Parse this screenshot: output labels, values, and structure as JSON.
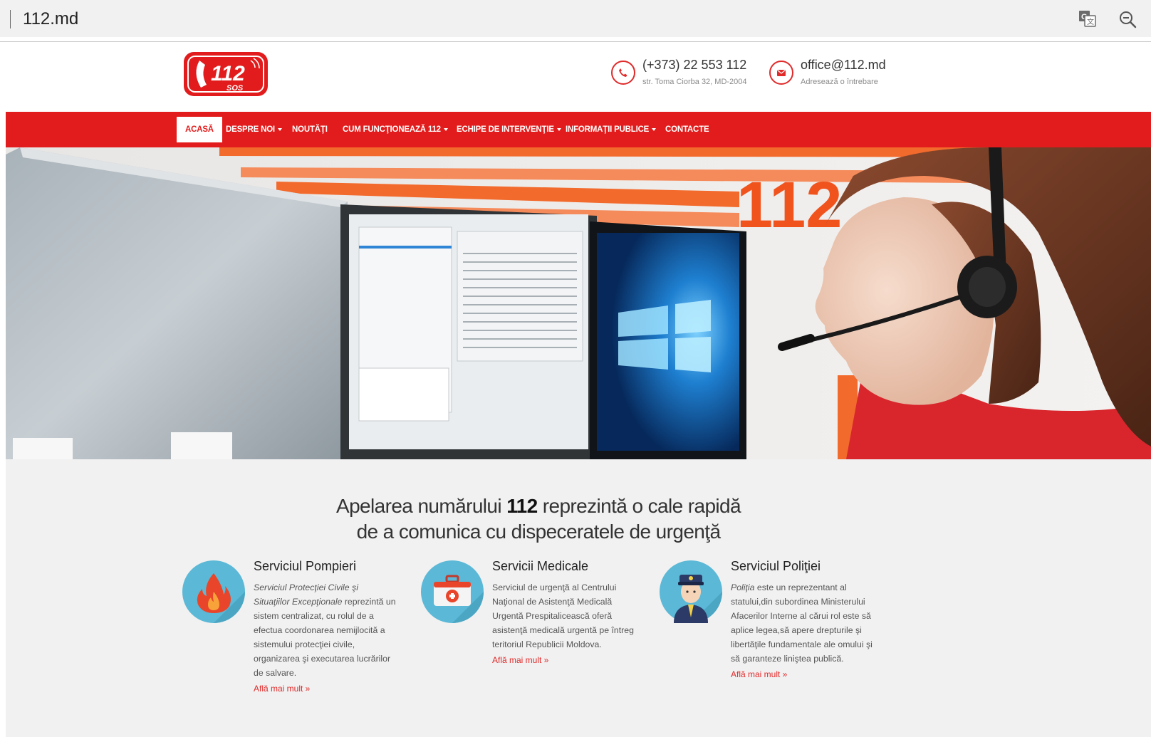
{
  "browser": {
    "url": "112.md",
    "icons": [
      "translate-icon",
      "zoom-out-icon"
    ]
  },
  "header": {
    "logo": {
      "main": "112",
      "sub": "SOS"
    },
    "phone": {
      "main": "(+373) 22 553 112",
      "sub": "str. Toma Ciorba 32, MD-2004",
      "icon": "phone-icon"
    },
    "email": {
      "main": "office@112.md",
      "sub": "Adresează o întrebare",
      "icon": "envelope-icon"
    }
  },
  "nav": {
    "items": [
      {
        "label": "ACASĂ",
        "active": true,
        "dropdown": false
      },
      {
        "label": "DESPRE NOI",
        "dropdown": true
      },
      {
        "label": "NOUTĂŢI",
        "dropdown": false
      },
      {
        "label": "CUM FUNCŢIONEAZĂ 112",
        "dropdown": true
      },
      {
        "label": "ECHIPE DE INTERVENŢIE",
        "dropdown": true
      },
      {
        "label": "INFORMAŢII PUBLICE",
        "dropdown": true
      },
      {
        "label": "CONTACTE",
        "dropdown": false
      }
    ]
  },
  "hero": {
    "wall_text": "112"
  },
  "tagline": {
    "line1_before": "Apelarea numărului ",
    "line1_bold": "112",
    "line1_after": " reprezintă o cale rapidă",
    "line2": "de a comunica cu dispeceratele de urgenţă"
  },
  "services": [
    {
      "title": "Serviciul Pompieri",
      "desc_italic": "Serviciul Protecţiei Civile şi Situaţiilor Excepţionale",
      "desc": " reprezintă un sistem centralizat, cu rolul de a efectua coordonarea nemijlocită a sistemului protecţiei civile, organizarea şi executarea lucrărilor de salvare.",
      "more": "Află mai mult »",
      "icon": "fire-icon"
    },
    {
      "title": "Servicii Medicale",
      "desc_italic": "",
      "desc": "Serviciul de urgenţă al Centrului Naţional de Asistenţă Medicală Urgentă Prespitalicească oferă asistenţă medicală urgentă pe întreg teritoriul Republicii Moldova.",
      "more": "Află mai mult »",
      "icon": "medical-kit-icon"
    },
    {
      "title": "Serviciul Poliţiei",
      "desc_italic": "Poliţia",
      "desc": " este un reprezentant al statului,din subordinea Ministerului Afacerilor Interne al cărui rol este să aplice legea,să apere drepturile şi libertăţile fundamentale ale omului şi să garanteze liniştea publică.",
      "more": "Află mai mult »",
      "icon": "police-officer-icon"
    }
  ],
  "colors": {
    "brand_red": "#e21c1c",
    "link_red": "#e12a2a",
    "icon_circle": "#5bb8d6",
    "content_bg": "#f1f1f1"
  }
}
